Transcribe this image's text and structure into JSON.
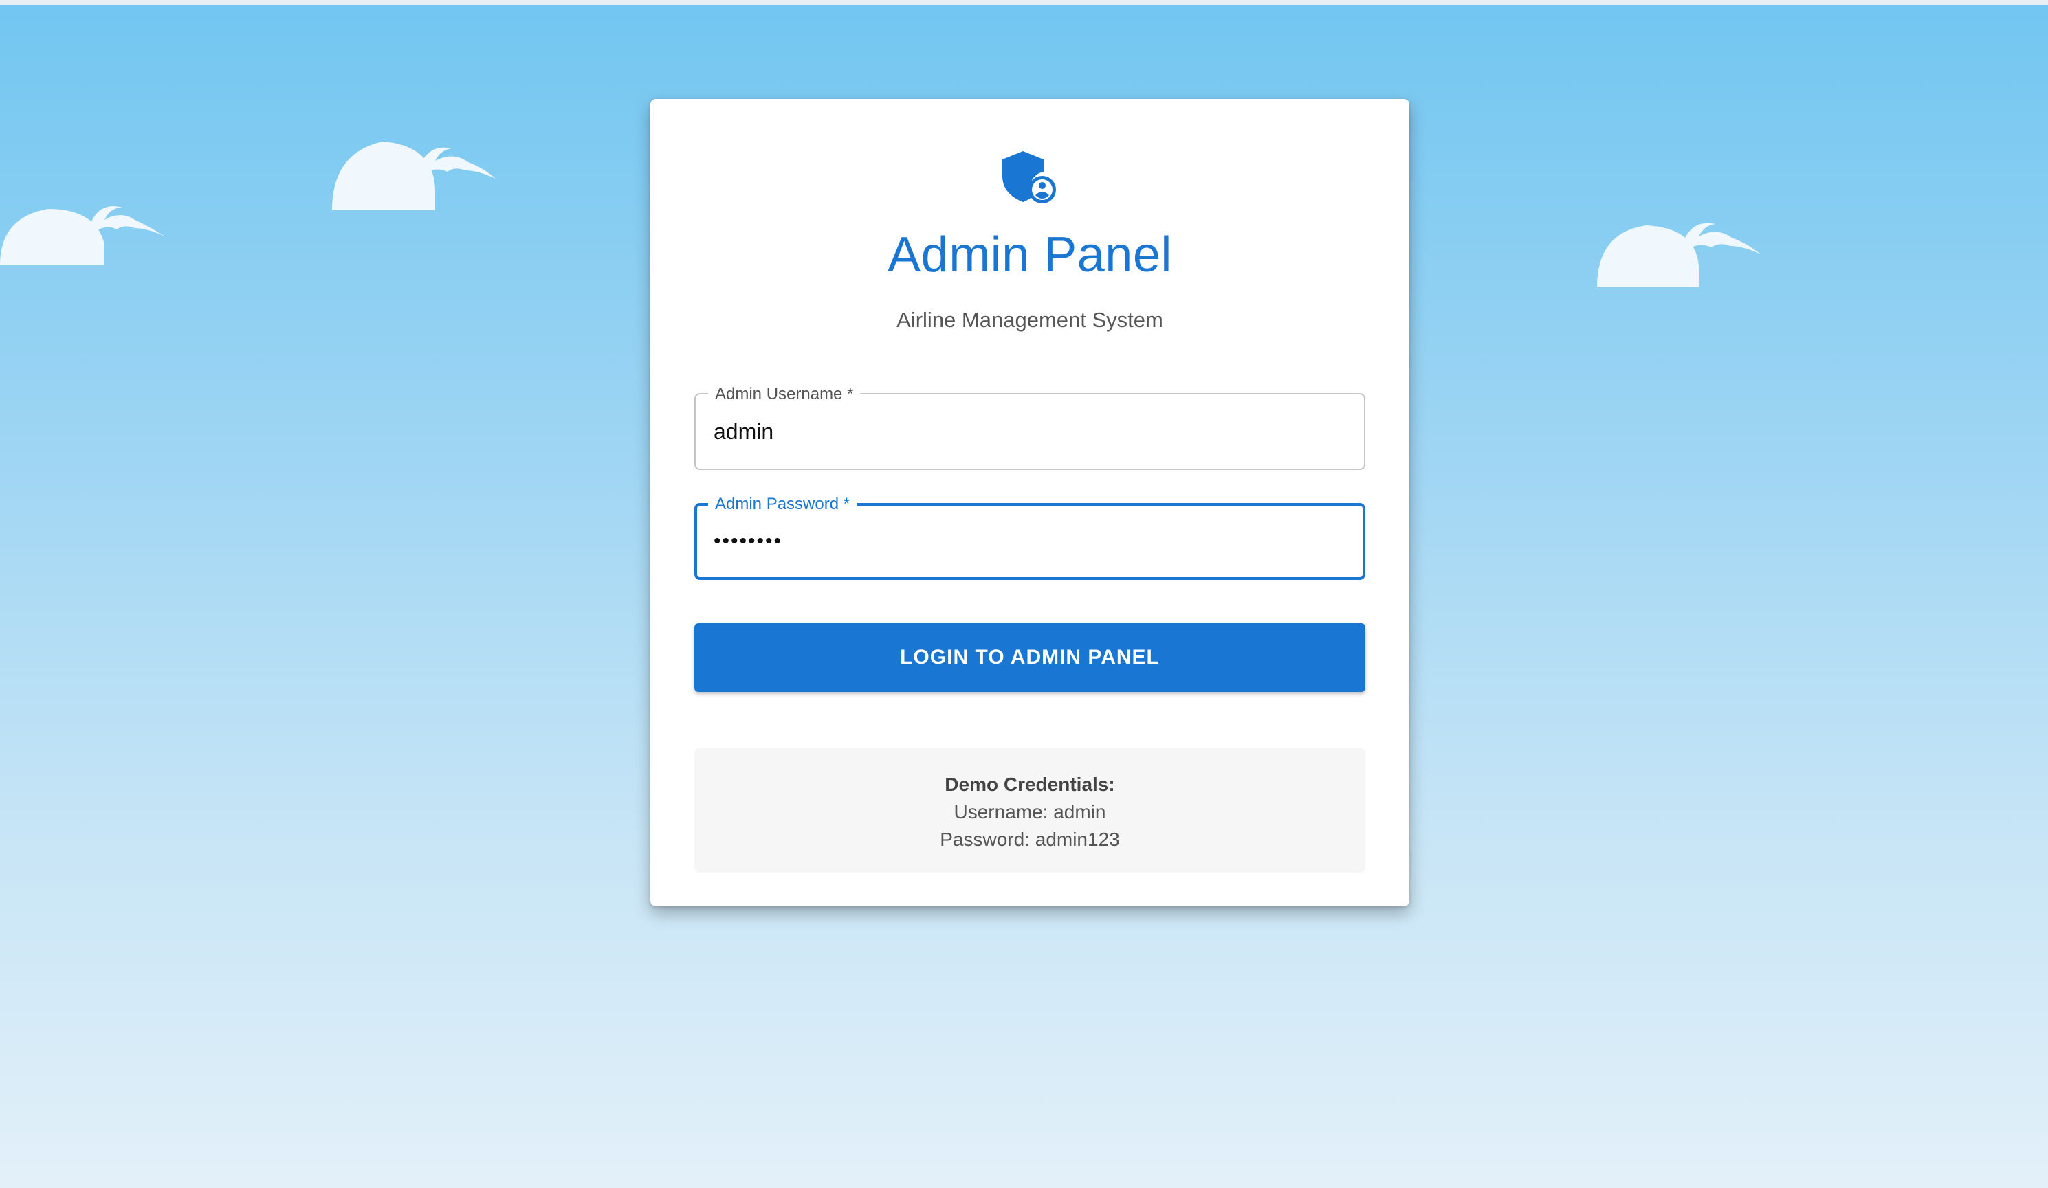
{
  "page": {
    "background_top_color": "#72c6f1",
    "background_bottom_color": "#e3f0f9",
    "accent_color": "#1976d2"
  },
  "login_card": {
    "logo_icon": "admin-shield-icon",
    "title": "Admin Panel",
    "subtitle": "Airline Management System",
    "username_field": {
      "label": "Admin Username *",
      "value": "admin"
    },
    "password_field": {
      "label": "Admin Password *",
      "value": "••••••••",
      "focused": true
    },
    "login_button_label": "LOGIN TO ADMIN PANEL",
    "demo_credentials": {
      "heading": "Demo Credentials:",
      "username_line": "Username: admin",
      "password_line": "Password: admin123"
    }
  },
  "decorations": {
    "clouds": [
      "cloud-icon",
      "cloud-icon",
      "cloud-icon"
    ]
  }
}
